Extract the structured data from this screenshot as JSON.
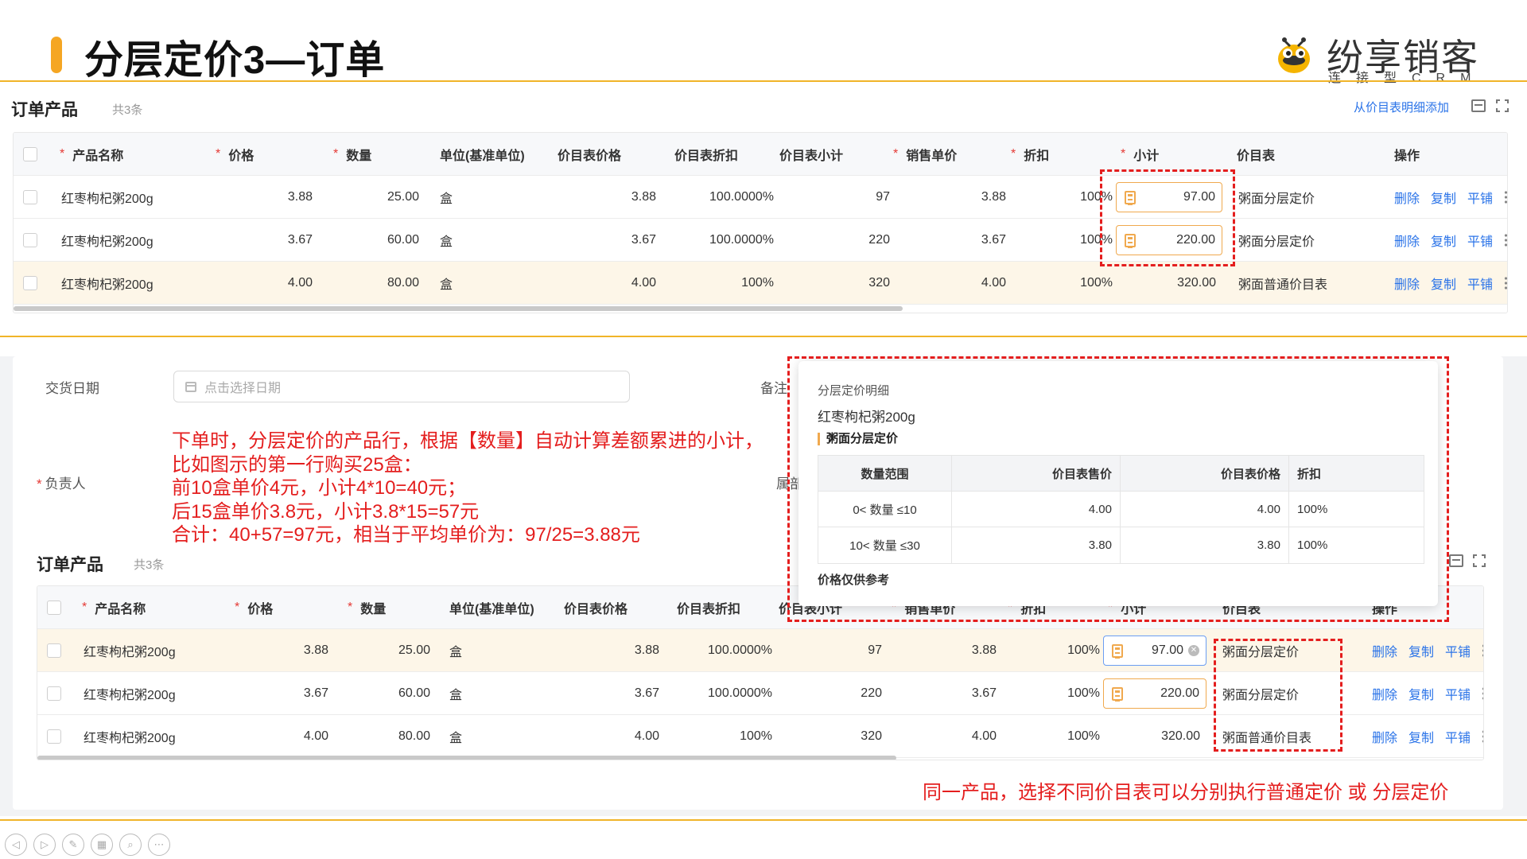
{
  "slide": {
    "title": "分层定价3—订单",
    "logo_name": "纷享销客",
    "logo_tagline": "连接型CRM"
  },
  "top_panel": {
    "section_title": "订单产品",
    "count": "共3条",
    "add_link": "从价目表明细添加",
    "columns": [
      "产品名称",
      "价格",
      "数量",
      "单位(基准单位)",
      "价目表价格",
      "价目表折扣",
      "价目表小计",
      "销售单价",
      "折扣",
      "小计",
      "价目表",
      "操作"
    ],
    "rows": [
      {
        "name": "红枣枸杞粥200g",
        "price": "3.88",
        "qty": "25.00",
        "unit": "盒",
        "pl_price": "3.88",
        "pl_discount": "100.0000%",
        "pl_subtotal": "97",
        "unit_price": "3.88",
        "discount": "100%",
        "subtotal": "97.00",
        "pricelist": "粥面分层定价"
      },
      {
        "name": "红枣枸杞粥200g",
        "price": "3.67",
        "qty": "60.00",
        "unit": "盒",
        "pl_price": "3.67",
        "pl_discount": "100.0000%",
        "pl_subtotal": "220",
        "unit_price": "3.67",
        "discount": "100%",
        "subtotal": "220.00",
        "pricelist": "粥面分层定价"
      },
      {
        "name": "红枣枸杞粥200g",
        "price": "4.00",
        "qty": "80.00",
        "unit": "盒",
        "pl_price": "4.00",
        "pl_discount": "100%",
        "pl_subtotal": "320",
        "unit_price": "4.00",
        "discount": "100%",
        "subtotal": "320.00",
        "pricelist": "粥面普通价目表"
      }
    ],
    "actions": [
      "删除",
      "复制",
      "平铺"
    ]
  },
  "bottom_panel": {
    "delivery_label": "交货日期",
    "date_placeholder": "点击选择日期",
    "remark_label": "备注",
    "owner_label": "负责人",
    "dept_label": "属部",
    "section_title": "订单产品",
    "count": "共3条",
    "columns": [
      "产品名称",
      "价格",
      "数量",
      "单位(基准单位)",
      "价目表价格",
      "价目表折扣",
      "价目表小计",
      "销售单价",
      "折扣",
      "小计",
      "价目表",
      "操作"
    ],
    "rows": [
      {
        "name": "红枣枸杞粥200g",
        "price": "3.88",
        "qty": "25.00",
        "unit": "盒",
        "pl_price": "3.88",
        "pl_discount": "100.0000%",
        "pl_subtotal": "97",
        "unit_price": "3.88",
        "discount": "100%",
        "subtotal": "97.00",
        "pricelist": "粥面分层定价"
      },
      {
        "name": "红枣枸杞粥200g",
        "price": "3.67",
        "qty": "60.00",
        "unit": "盒",
        "pl_price": "3.67",
        "pl_discount": "100.0000%",
        "pl_subtotal": "220",
        "unit_price": "3.67",
        "discount": "100%",
        "subtotal": "220.00",
        "pricelist": "粥面分层定价"
      },
      {
        "name": "红枣枸杞粥200g",
        "price": "4.00",
        "qty": "80.00",
        "unit": "盒",
        "pl_price": "4.00",
        "pl_discount": "100%",
        "pl_subtotal": "320",
        "unit_price": "4.00",
        "discount": "100%",
        "subtotal": "320.00",
        "pricelist": "粥面普通价目表"
      }
    ],
    "actions": [
      "删除",
      "复制",
      "平铺"
    ]
  },
  "annotation": {
    "lines": [
      "下单时，分层定价的产品行，根据【数量】自动计算差额累进的小计，",
      "比如图示的第一行购买25盒：",
      "前10盒单价4元，小计4*10=40元；",
      "后15盒单价3.8元，小计3.8*15=57元",
      "合计：40+57=97元，相当于平均单价为：97/25=3.88元"
    ],
    "bottom_note": "同一产品，选择不同价目表可以分别执行普通定价 或 分层定价"
  },
  "popover": {
    "title": "分层定价明细",
    "product": "红枣枸杞粥200g",
    "section": "粥面分层定价",
    "headers": [
      "数量范围",
      "价目表售价",
      "价目表价格",
      "折扣"
    ],
    "rows": [
      {
        "range": "0< 数量 ≤10",
        "sale_price": "4.00",
        "pl_price": "4.00",
        "discount": "100%"
      },
      {
        "range": "10< 数量 ≤30",
        "sale_price": "3.80",
        "pl_price": "3.80",
        "discount": "100%"
      }
    ],
    "note": "价格仅供参考"
  },
  "colors": {
    "accent": "#f5a623",
    "link": "#2a73e8",
    "annotation": "#e41e1e",
    "highlight_row": "#fdf6e8"
  }
}
